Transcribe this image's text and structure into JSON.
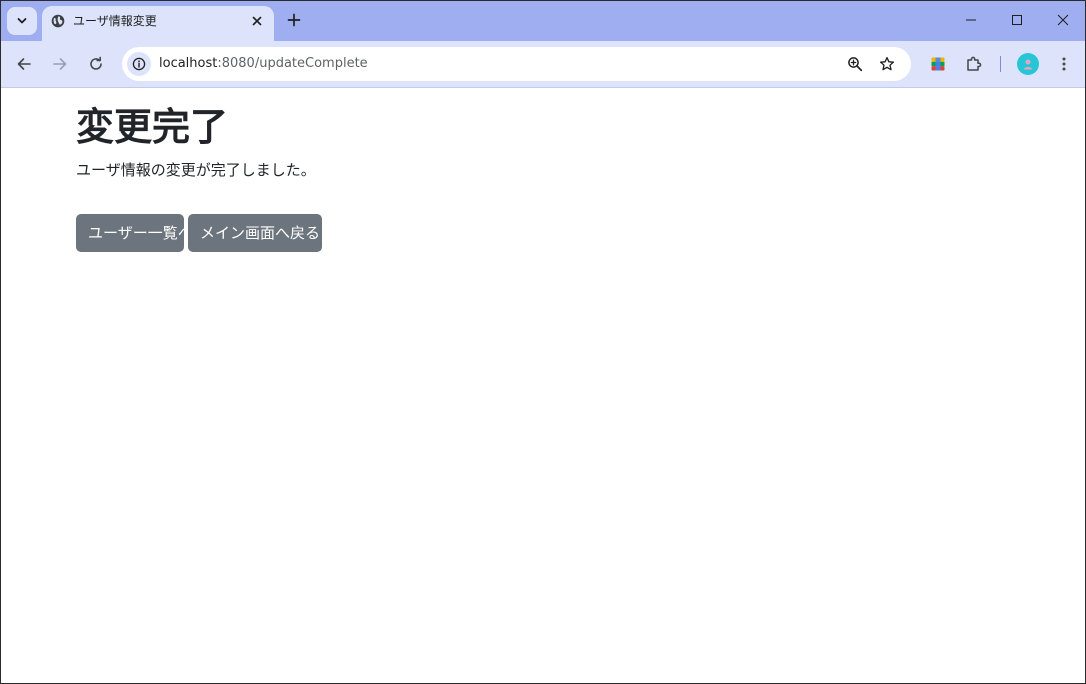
{
  "browser": {
    "tab": {
      "title": "ユーザ情報変更",
      "favicon": "globe-icon"
    },
    "address": {
      "host": "localhost",
      "path": ":8080/updateComplete"
    },
    "colors": {
      "tabstrip": "#9eaef0",
      "toolbar": "#dde3fa",
      "avatar": "#27c6d6"
    }
  },
  "page": {
    "title": "変更完了",
    "message": "ユーザ情報の変更が完了しました。",
    "buttons": {
      "user_list": "ユーザー一覧へ",
      "back_to_main": "メイン画面へ戻る"
    },
    "colors": {
      "button_bg": "#6c757d",
      "button_text": "#ffffff",
      "text": "#212529"
    }
  }
}
